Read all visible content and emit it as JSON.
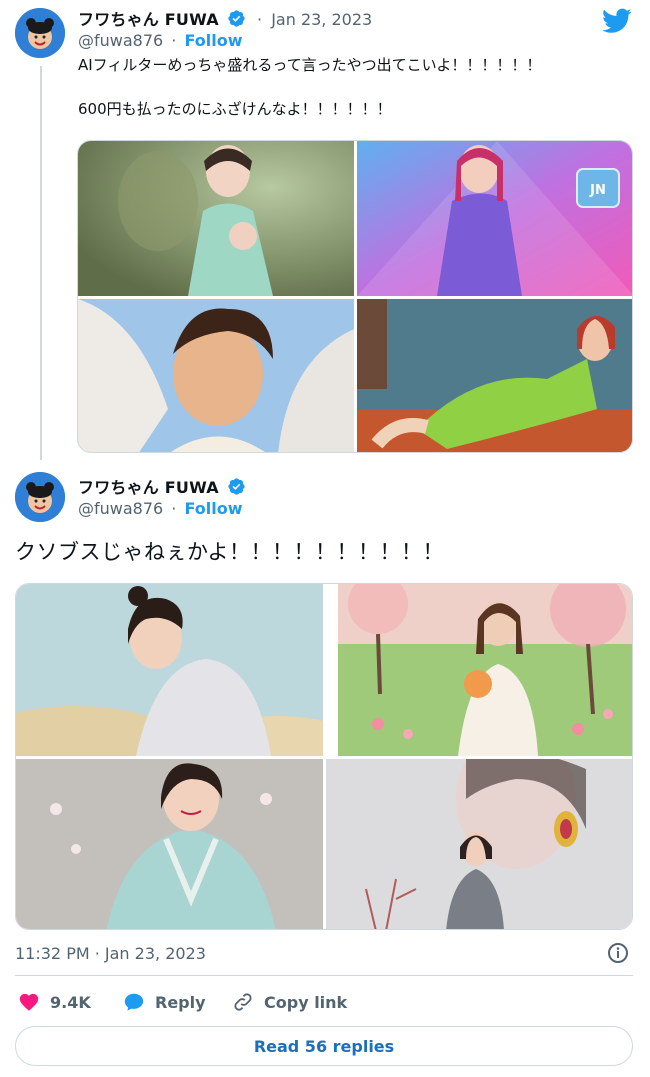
{
  "tweet1": {
    "display_name": "フワちゃん FUWA",
    "separator": "·",
    "date": "Jan 23, 2023",
    "handle": "@fuwa876",
    "follow_label": "Follow",
    "line1": "AIフィルターめっちゃ盛れるって言ったやつ出てこいよ！！！！！！",
    "line2": "600円も払ったのにふざけんなよ！！！！！！",
    "media": [
      "portrait-mint-dress",
      "portrait-pink-tattoo",
      "portrait-angel-wings",
      "portrait-green-swimsuit"
    ]
  },
  "tweet2": {
    "display_name": "フワちゃん FUWA",
    "handle": "@fuwa876",
    "separator": "·",
    "follow_label": "Follow",
    "text": "クソブスじゃねぇかよ！！！！！！！！！！",
    "media": [
      "portrait-gray-sweater",
      "portrait-flower-field",
      "portrait-kimono",
      "portrait-earring"
    ]
  },
  "footer": {
    "timestamp": "11:32 PM · Jan 23, 2023",
    "likes": "9.4K",
    "reply_label": "Reply",
    "copy_link_label": "Copy link",
    "read_replies_label": "Read 56 replies"
  },
  "icons": {
    "brand": "twitter-bird-icon",
    "verified": "verified-badge-icon",
    "like": "heart-icon",
    "reply": "reply-bubble-icon",
    "copy": "link-icon",
    "info": "info-icon"
  },
  "colors": {
    "twitter_blue": "#1d9bf0",
    "like_red": "#f91880",
    "text_primary": "#0f1419",
    "text_secondary": "#536471",
    "border": "#cfd9de"
  }
}
